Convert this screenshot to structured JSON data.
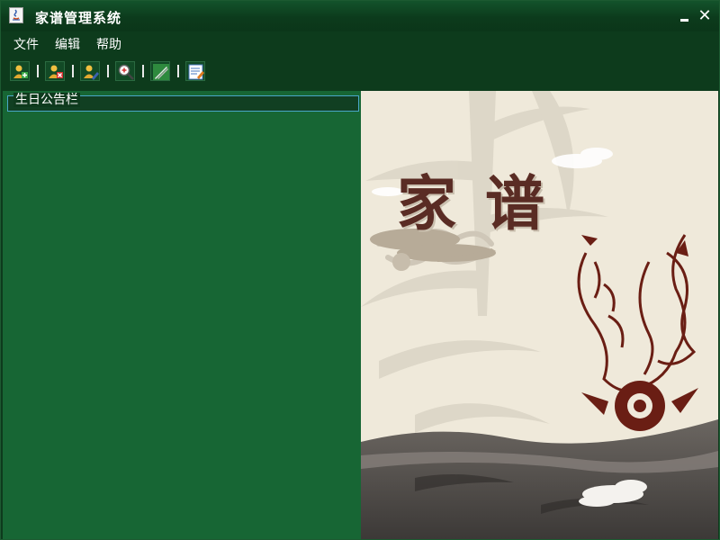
{
  "window": {
    "title": "家谱管理系统",
    "controls": {
      "minimize_icon": "minimize-icon",
      "close_label": "✕"
    }
  },
  "menu": {
    "items": [
      {
        "label": "文件"
      },
      {
        "label": "编辑"
      },
      {
        "label": "帮助"
      }
    ]
  },
  "toolbar": {
    "buttons": [
      {
        "icon": "add-person-icon"
      },
      {
        "icon": "delete-person-icon"
      },
      {
        "icon": "edit-person-icon"
      },
      {
        "icon": "search-icon"
      },
      {
        "icon": "pencil-icon"
      },
      {
        "icon": "notepad-icon"
      }
    ]
  },
  "left_panel": {
    "birthday_board_title": "生日公告栏"
  },
  "cover": {
    "title_char_1": "家",
    "title_char_2": "谱"
  },
  "colors": {
    "title_bar": "#0c3b1c",
    "panel_green": "#176634",
    "border_accent": "#49a6c6",
    "cover_paper": "#efe9da",
    "cover_ink": "#5a2c24"
  }
}
